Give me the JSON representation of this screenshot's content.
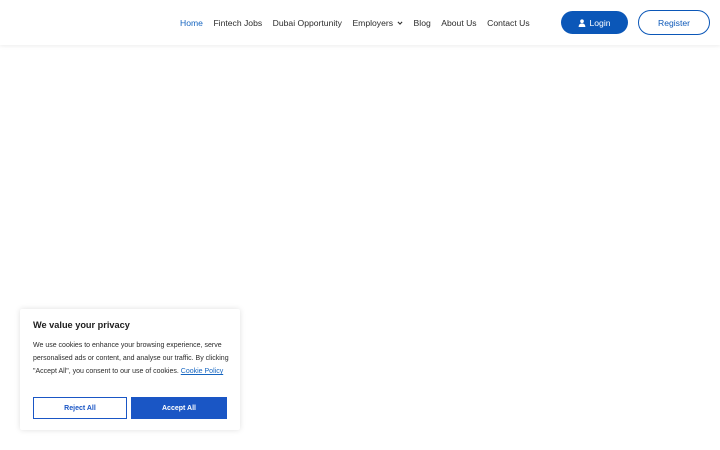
{
  "nav": {
    "items": [
      {
        "label": "Home",
        "active": true
      },
      {
        "label": "Fintech Jobs",
        "active": false
      },
      {
        "label": "Dubai Opportunity",
        "active": false
      },
      {
        "label": "Employers",
        "active": false,
        "dropdown": true
      },
      {
        "label": "Blog",
        "active": false
      },
      {
        "label": "About Us",
        "active": false
      },
      {
        "label": "Contact Us",
        "active": false
      }
    ],
    "login_label": "Login",
    "register_label": "Register"
  },
  "cookie_banner": {
    "title": "We value your privacy",
    "text": "We use cookies to enhance your browsing experience, serve personalised ads or content, and analyse our traffic. By clicking \"Accept All\", you consent to our use of cookies.",
    "link_label": "Cookie Policy",
    "reject_label": "Reject All",
    "accept_label": "Accept All"
  },
  "colors": {
    "accent": "#0b57b8",
    "active_link": "#1565c0",
    "cookie_button": "#1a56c5"
  },
  "icons": {
    "login": "user-icon",
    "dropdown": "chevron-down-icon"
  }
}
